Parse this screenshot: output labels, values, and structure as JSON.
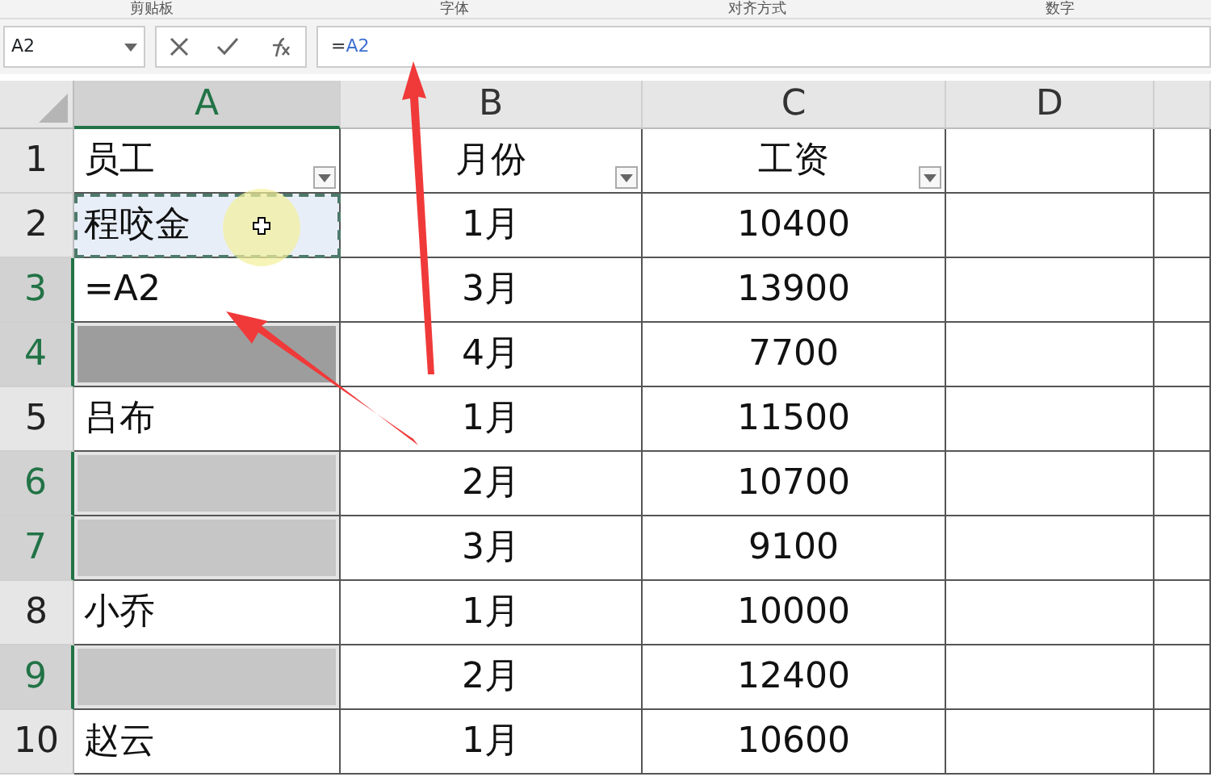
{
  "ribbon_groups": [
    "剪贴板",
    "字体",
    "对齐方式",
    "数字"
  ],
  "name_box": "A2",
  "formula_bar": {
    "parts": [
      {
        "text": "=",
        "kind": "plain"
      },
      {
        "text": "A2",
        "kind": "ref"
      }
    ]
  },
  "columns": [
    {
      "label": "A",
      "selected": true
    },
    {
      "label": "B",
      "selected": false
    },
    {
      "label": "C",
      "selected": false
    },
    {
      "label": "D",
      "selected": false
    }
  ],
  "rows": [
    {
      "number": "1",
      "selected": false,
      "cells": [
        "员工",
        "月份",
        "工资"
      ],
      "filter": true,
      "a_cell": {
        "selected": false,
        "copied": false,
        "dark": false
      }
    },
    {
      "number": "2",
      "selected": false,
      "cells": [
        "程咬金",
        "1月",
        "10400"
      ],
      "a_cell": {
        "selected": false,
        "copied": true,
        "dark": false
      }
    },
    {
      "number": "3",
      "selected": true,
      "cells": [
        "=A2",
        "3月",
        "13900"
      ],
      "a_cell": {
        "selected": false,
        "copied": false,
        "dark": false
      }
    },
    {
      "number": "4",
      "selected": true,
      "cells": [
        "",
        "4月",
        "7700"
      ],
      "a_cell": {
        "selected": true,
        "copied": false,
        "dark": true
      }
    },
    {
      "number": "5",
      "selected": false,
      "cells": [
        "吕布",
        "1月",
        "11500"
      ],
      "a_cell": {
        "selected": false,
        "copied": false,
        "dark": false
      }
    },
    {
      "number": "6",
      "selected": true,
      "cells": [
        "",
        "2月",
        "10700"
      ],
      "a_cell": {
        "selected": true,
        "copied": false,
        "dark": false
      }
    },
    {
      "number": "7",
      "selected": true,
      "cells": [
        "",
        "3月",
        "9100"
      ],
      "a_cell": {
        "selected": true,
        "copied": false,
        "dark": false
      }
    },
    {
      "number": "8",
      "selected": false,
      "cells": [
        "小乔",
        "1月",
        "10000"
      ],
      "a_cell": {
        "selected": false,
        "copied": false,
        "dark": false
      }
    },
    {
      "number": "9",
      "selected": true,
      "cells": [
        "",
        "2月",
        "12400"
      ],
      "a_cell": {
        "selected": true,
        "copied": false,
        "dark": false
      }
    },
    {
      "number": "10",
      "selected": false,
      "cells": [
        "赵云",
        "1月",
        "10600"
      ],
      "a_cell": {
        "selected": false,
        "copied": false,
        "dark": false
      }
    }
  ]
}
